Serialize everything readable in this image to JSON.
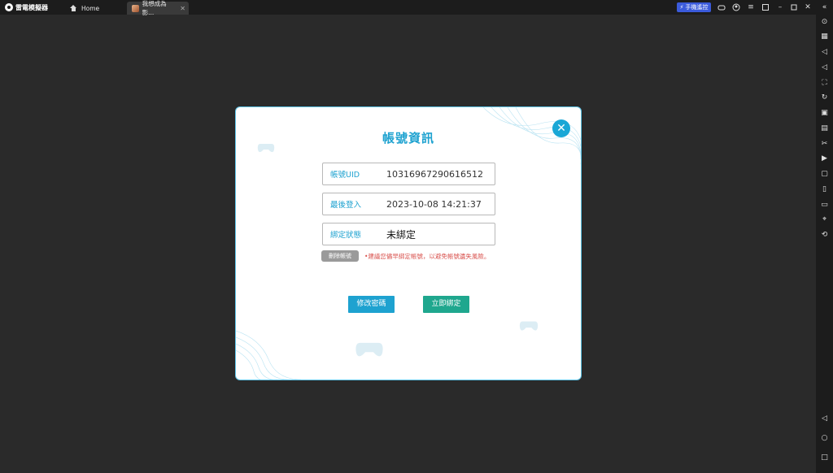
{
  "app": {
    "logo_text": "雷電模擬器",
    "tabs": [
      {
        "label": "Home"
      },
      {
        "label": "我想成為影..."
      }
    ],
    "remote_button": "手機遙控",
    "accent_color": "#3b5bdb"
  },
  "dialog": {
    "title": "帳號資訊",
    "fields": [
      {
        "label": "帳號UID",
        "value": "10316967290616512"
      },
      {
        "label": "最後登入",
        "value": "2023-10-08 14:21:37"
      },
      {
        "label": "綁定狀態",
        "value": "未綁定"
      }
    ],
    "delete_button": "刪除帳號",
    "warning": "•建議您儘早綁定帳號，以避免帳號遺失風險。",
    "change_password_button": "修改密碼",
    "bind_now_button": "立即綁定",
    "title_color": "#1ea2d0",
    "warning_color": "#d9534f"
  },
  "icons": {
    "titlebar": [
      "gamepad-icon",
      "user-icon",
      "menu-icon",
      "window-icon",
      "minimize-icon",
      "maximize-icon",
      "close-icon"
    ],
    "sidebar": [
      "collapse-icon",
      "settings-icon",
      "keyboard-icon",
      "volume-up-icon",
      "volume-down-icon",
      "screenshot-icon",
      "sync-icon",
      "apk-icon",
      "macro-icon",
      "cut-icon",
      "record-icon",
      "multi-window-icon",
      "shake-icon",
      "folder-icon",
      "location-icon",
      "rotate-icon",
      "back-icon",
      "home-icon",
      "recent-apps-icon"
    ]
  }
}
